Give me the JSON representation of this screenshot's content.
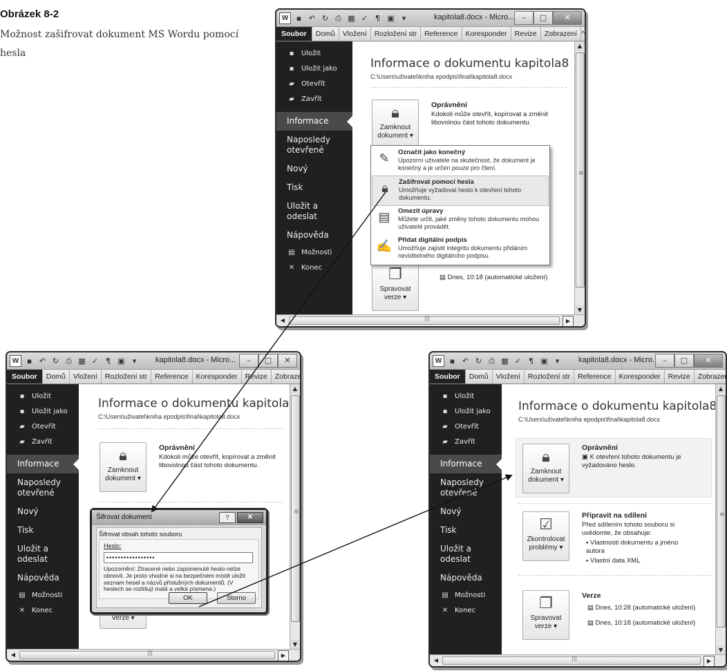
{
  "caption": {
    "title": "Obrázek 8-2",
    "text": "Možnost zašifrovat dokument MS Wordu pomocí hesla"
  },
  "common": {
    "window_title": "kapitola8.docx - Micro...",
    "tabs": [
      "Soubor",
      "Domů",
      "Vložení",
      "Rozložení str",
      "Reference",
      "Koresponder",
      "Revize",
      "Zobrazení"
    ],
    "sidebar_small": [
      "Uložit",
      "Uložit jako",
      "Otevřít",
      "Zavřít"
    ],
    "sidebar_big": [
      "Informace",
      "Naposledy otevřené",
      "Nový",
      "Tisk",
      "Uložit a odeslat",
      "Nápověda"
    ],
    "sidebar_bottom": [
      "Možnosti",
      "Konec"
    ],
    "info_title": "Informace o dokumentu kapitola8",
    "info_path": "C:\\Users\\uživatel\\kniha epodpis\\final\\kapitola8.docx",
    "lock_button": "Zamknout dokument ▾",
    "permissions_heading": "Oprávnění",
    "permissions_text": "Kdokoli může otevřít, kopírovat a změnit libovolnou část tohoto dokumentu.",
    "versions_button": "Spravovat verze ▾",
    "version_entry_2": "Dnes, 10:18 (automatické uložení)"
  },
  "top": {
    "dropdown": [
      {
        "title": "Označit jako konečný",
        "text": "Upozorní uživatele na skutečnost, že dokument je konečný a je určen pouze pro čtení."
      },
      {
        "title": "Zašifrovat pomocí hesla",
        "text": "Umožňuje vyžadovat heslo k otevření tohoto dokumentu."
      },
      {
        "title": "Omezit úpravy",
        "text": "Můžete určit, jaké změny tohoto dokumentu mohou uživatelé provádět."
      },
      {
        "title": "Přidat digitální podpis",
        "text": "Umožňuje zajistit integritu dokumentu přidáním neviditelného digitálního podpisu."
      }
    ],
    "sidebar_bottom_1": "Konec"
  },
  "dialog": {
    "title": "Šifrovat dokument",
    "group": "Šifrovat obsah tohoto souboru",
    "label": "Heslo:",
    "password": "•••••••••••••••••",
    "warning": "Upozornění: Ztracené nebo zapomenuté heslo nelze obnovit. Je proto vhodné si na bezpečném místě uložit seznam hesel a názvů příslušných dokumentů. (V heslech se rozlišují malá a velká písmena.)",
    "ok": "OK",
    "cancel": "Storno",
    "behind_button": "Verze ▾"
  },
  "right": {
    "permissions_text": "K otevření tohoto dokumentu je vyžadováno heslo.",
    "prepare_heading": "Připravit na sdílení",
    "prepare_text": "Před sdílením tohoto souboru si uvědomte, že obsahuje:",
    "prepare_items": [
      "Vlastnosti dokumentu a jméno autora",
      "Vlastní data XML"
    ],
    "check_button": "Zkontrolovat problémy ▾",
    "versions_heading": "Verze",
    "version_entry_1": "Dnes, 10:28 (automatické uložení)"
  }
}
